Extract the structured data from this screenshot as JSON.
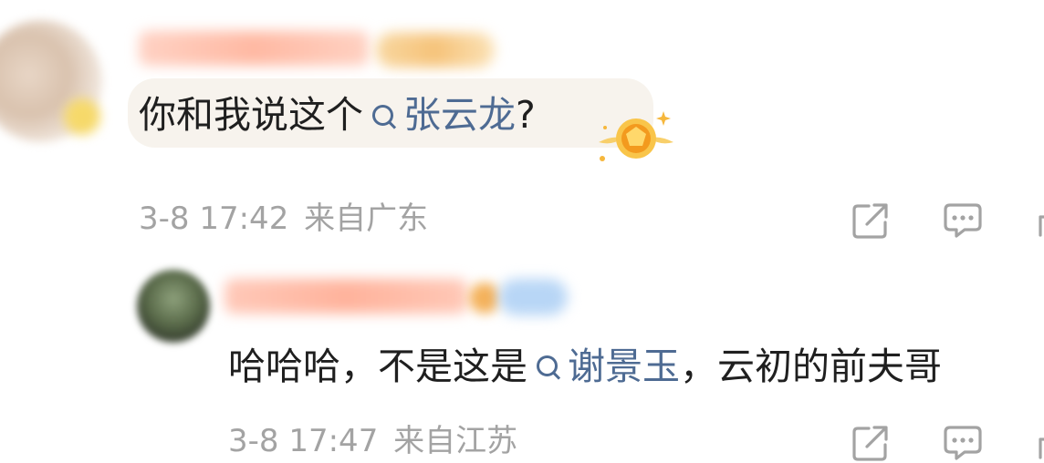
{
  "comments": [
    {
      "text_before": "你和我说这个",
      "topic": "张云龙",
      "text_after": "?",
      "time": "3-8 17:42",
      "location": "来自广东"
    },
    {
      "text_before": "哈哈哈，不是这是",
      "topic": "谢景玉",
      "text_after": "，云初的前夫哥",
      "time": "3-8 17:47",
      "location": "来自江苏"
    }
  ],
  "icons": {
    "topic": "search-icon",
    "share": "share-icon",
    "comment": "comment-icon",
    "like": "like-icon",
    "medal": "medal-icon"
  },
  "colors": {
    "topic_link": "#4e6b93",
    "meta_text": "#a3a3a3",
    "bubble": "#f7f3ed",
    "medal": "#f6b73c"
  }
}
